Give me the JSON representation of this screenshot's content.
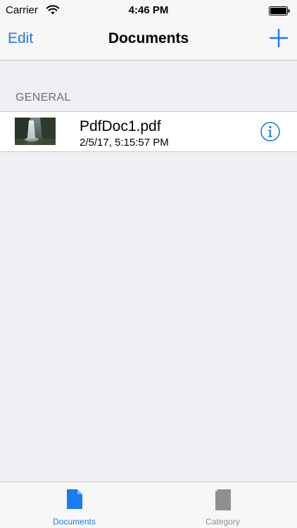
{
  "status_bar": {
    "carrier": "Carrier",
    "time": "4:46 PM",
    "icons": [
      "wifi-icon",
      "battery-icon"
    ]
  },
  "nav": {
    "edit_label": "Edit",
    "title": "Documents",
    "add_icon": "plus-icon"
  },
  "section": {
    "header": "GENERAL"
  },
  "documents": [
    {
      "name": "PdfDoc1.pdf",
      "date": "2/5/17, 5:15:57 PM",
      "thumbnail": "waterfall-thumbnail",
      "accessory_icon": "info-icon"
    }
  ],
  "tabs": [
    {
      "label": "Documents",
      "icon": "document-icon",
      "selected": true
    },
    {
      "label": "Category",
      "icon": "category-icon",
      "selected": false
    }
  ],
  "colors": {
    "accent": "#1a7bf2",
    "background": "#efeff4",
    "bar": "#f7f7f7",
    "section_text": "#6d6d72",
    "tab_inactive": "#8e8e93"
  }
}
